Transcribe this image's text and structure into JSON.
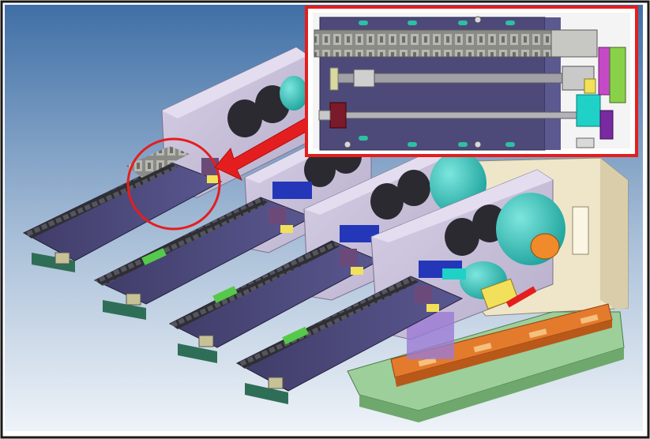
{
  "scene": {
    "subject": "cad-assembly-render",
    "modules": 4,
    "colors": {
      "background_top": "#3f6fa6",
      "background_bottom": "#eef3f8",
      "housing": "#c9c0d8",
      "rail_plate": "#4d4a7a",
      "cable_chain": "#2e2e34",
      "spool_teal": "#1fb8b0",
      "roller_dark": "#2a2a30",
      "base_green": "#9ccf9a",
      "base_orange": "#e47a2c",
      "cabinet_beige": "#efe6c9",
      "highlight_red": "#e41e1e",
      "accent_yellow": "#f3e05a",
      "accent_orange": "#f08a2a"
    }
  },
  "annotations": {
    "circle": "detail-circle",
    "arrow": "pointer-arrow",
    "inset": "detail-inset"
  }
}
